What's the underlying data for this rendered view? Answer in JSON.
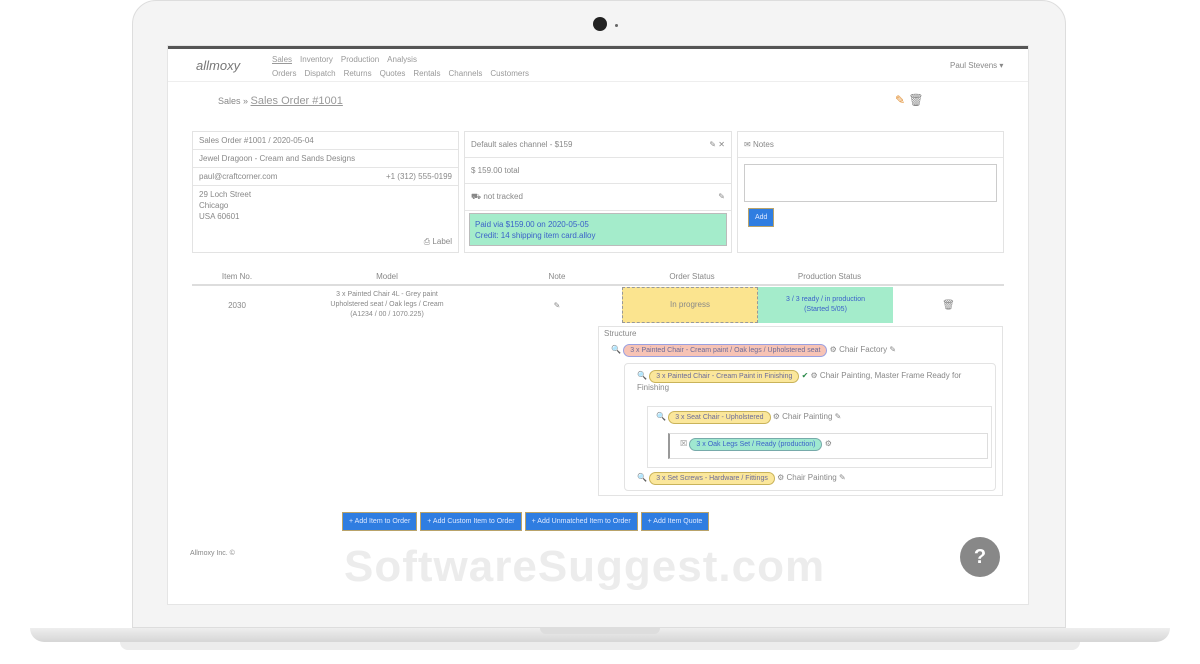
{
  "nav": {
    "logo": "allmoxy",
    "primary": [
      "Sales",
      "Inventory",
      "Production",
      "Analysis"
    ],
    "secondary": [
      "Orders",
      "Dispatch",
      "Returns",
      "Quotes",
      "Rentals",
      "Channels",
      "Customers"
    ],
    "user": "Paul Stevens"
  },
  "breadcrumb": {
    "parent": "Sales",
    "current": "Sales Order #1001"
  },
  "order": {
    "header": "Sales Order #1001 / 2020-05-04",
    "customer": "Jewel Dragoon - Cream and Sands Designs",
    "email": "paul@craftcorner.com",
    "phone": "+1 (312) 555-0199",
    "address": [
      "29 Loch Street",
      "Chicago",
      "USA 60601"
    ],
    "label_link": "Label"
  },
  "payment": {
    "header": "Default sales channel - $159",
    "total": "$ 159.00 total",
    "shipping": "not tracked",
    "note_line1": "Paid via $159.00 on 2020-05-05",
    "note_line2": "Credit: 14 shipping item card.alloy"
  },
  "notes": {
    "title": "Notes",
    "add": "Add"
  },
  "table": {
    "headers": [
      "Item No.",
      "Model",
      "Note",
      "Order Status",
      "Production Status"
    ],
    "row": {
      "item": "2030",
      "model_line1": "3 x Painted Chair 4L - Grey paint",
      "model_line2": "Upholstered seat / Oak legs / Cream",
      "model_line3": "(A1234 / 00 / 1070.225)",
      "order_status": "In progress",
      "production_status_1": "3 / 3 ready / in production",
      "production_status_2": "(Started 5/05)"
    }
  },
  "structure": {
    "title": "Structure",
    "nodes": [
      {
        "label": "3 x Painted Chair - Cream paint / Oak legs / Upholstered seat",
        "status": "Chair Factory",
        "color": "#f7c3b5"
      },
      {
        "label": "3 x Painted Chair - Cream Paint in Finishing",
        "status": "Chair Painting, Master Frame Ready for Finishing",
        "color": "#fbe79b"
      },
      {
        "label": "3 x Seat Chair - Upholstered",
        "status": "Chair Painting",
        "color": "#fbe79b"
      },
      {
        "label": "3 x Oak Legs Set / Ready (production)",
        "status": "",
        "color": "#9fe8d0"
      },
      {
        "label": "3 x Set Screws - Hardware / Fittings",
        "status": "Chair Painting",
        "color": "#fbe79b"
      }
    ]
  },
  "buttons": [
    "+ Add Item to Order",
    "+ Add Custom Item to Order",
    "+ Add Unmatched Item to Order",
    "+ Add Item Quote"
  ],
  "footer": "Allmoxy Inc. ©",
  "watermark": "SoftwareSuggest.com",
  "help": "?"
}
